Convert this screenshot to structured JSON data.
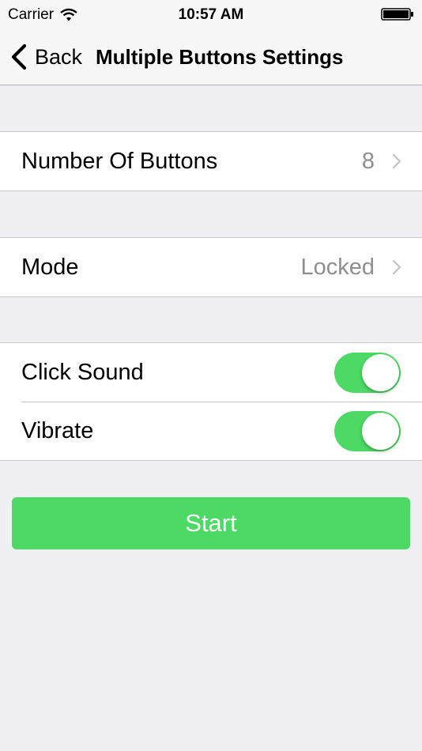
{
  "status_bar": {
    "carrier": "Carrier",
    "time": "10:57 AM"
  },
  "nav": {
    "back_label": "Back",
    "title": "Multiple Buttons Settings"
  },
  "settings": {
    "number_of_buttons": {
      "label": "Number Of Buttons",
      "value": "8"
    },
    "mode": {
      "label": "Mode",
      "value": "Locked"
    },
    "click_sound": {
      "label": "Click Sound",
      "on": true
    },
    "vibrate": {
      "label": "Vibrate",
      "on": true
    }
  },
  "start_button": {
    "label": "Start"
  },
  "colors": {
    "accent_green": "#4cd964",
    "background": "#efeff4",
    "secondary_text": "#8e8e93"
  },
  "icons": [
    "wifi-icon",
    "battery-icon",
    "chevron-left-icon",
    "chevron-right-icon"
  ]
}
